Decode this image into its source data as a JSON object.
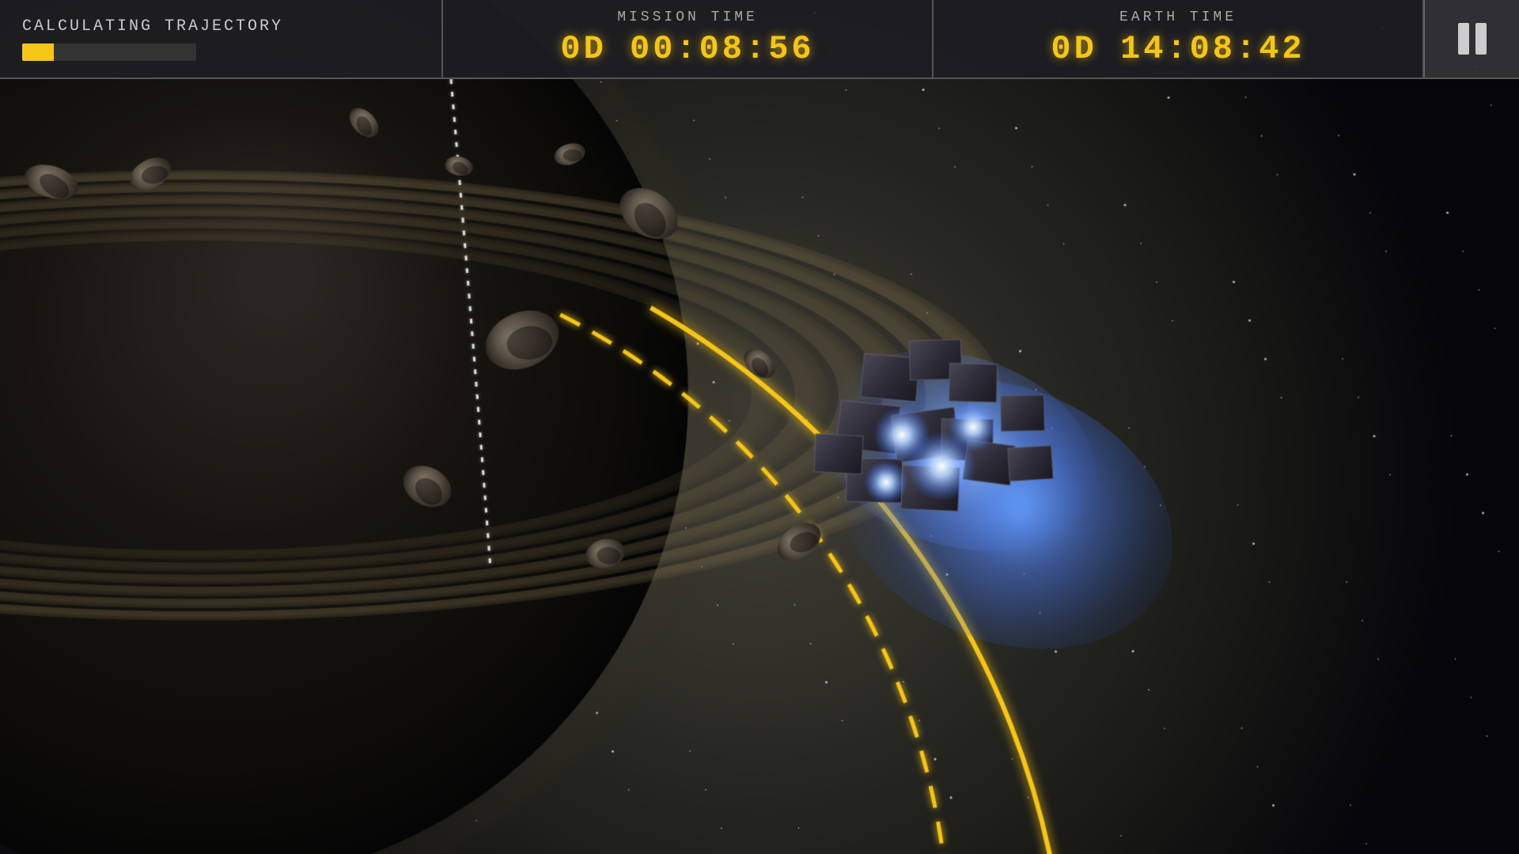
{
  "header": {
    "calculating_label": "CALCULATING TRAJECTORY",
    "progress_percent": 18,
    "mission_time_label": "MISSION TIME",
    "mission_time_value": "0D  00:08:56",
    "earth_time_label": "EARTH TIME",
    "earth_time_value": "0D  14:08:42"
  },
  "controls": {
    "pause_label": "Pause"
  },
  "colors": {
    "accent": "#f5c518",
    "background": "#000000",
    "hud_bg": "rgba(30,30,35,0.92)",
    "text_secondary": "#aaaaaa"
  }
}
